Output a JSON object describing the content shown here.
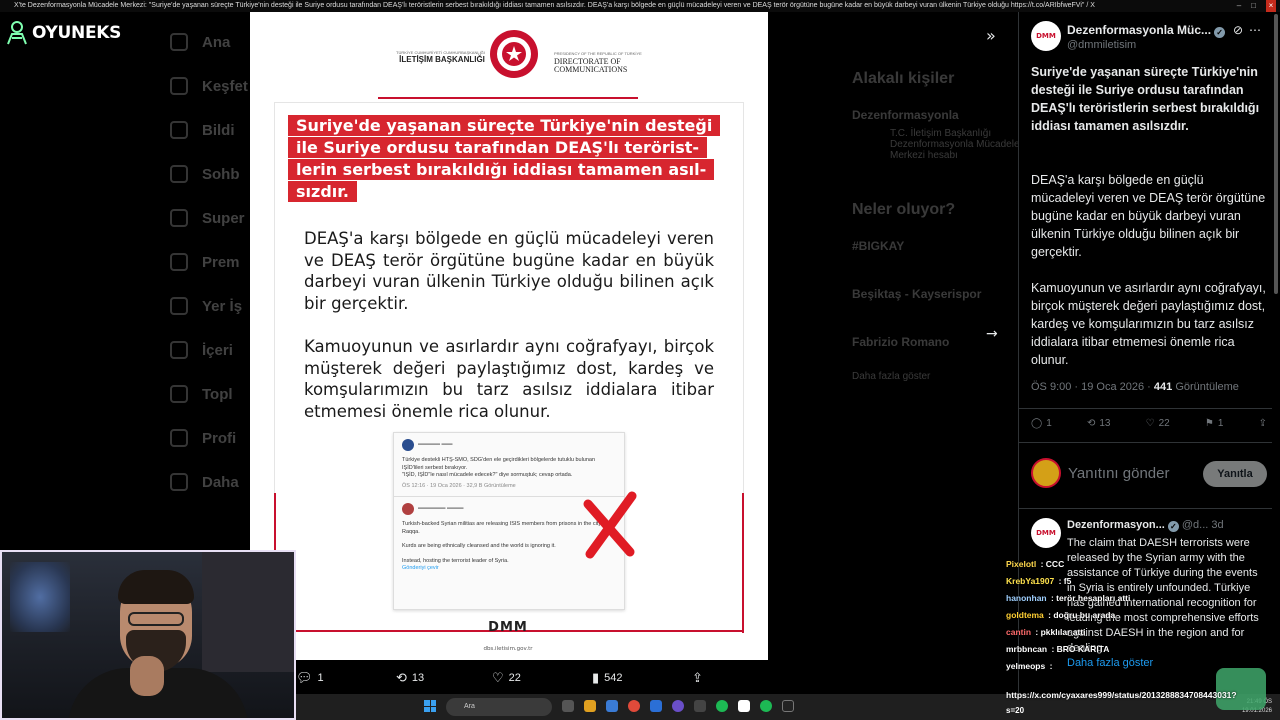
{
  "window": {
    "title": "X'te Dezenformasyonla Mücadele Merkezi: \"Suriye'de yaşanan süreçte Türkiye'nin desteği ile Suriye ordusu tarafından DEAŞ'lı teröristlerin serbest bırakıldığı iddiası tamamen asılsızdır. DEAŞ'a karşı bölgede en güçlü mücadeleyi veren ve DEAŞ terör örgütüne bugüne kadar en büyük darbeyi vuran ülkenin Türkiye olduğu https://t.co/ARIbfweFVi\" / X"
  },
  "overlay": {
    "logo_text": "OYUNEKS"
  },
  "leftnav": {
    "items": [
      "Ana",
      "Keşfet",
      "Bildi",
      "Sohb",
      "Super",
      "Prem",
      "Yer İş",
      "İçeri",
      "Topl",
      "Profi",
      "Daha"
    ]
  },
  "background_panel": {
    "related_title": "Alakalı kişiler",
    "related_name": "Dezenformasyonla",
    "related_bio": "T.C. İletişim Başkanlığı Dezenformasyonla Mücadele Merkezi hesabı",
    "trends_title": "Neler oluyor?",
    "trend1": "#BIGKAY",
    "trend2": "Beşiktaş - Kayserispor",
    "trend3": "Fabrizio Romano",
    "more": "Daha fazla göster"
  },
  "media": {
    "gov_left": "İLETİŞİM BAŞKANLIĞI",
    "gov_left_small": "TÜRKİYE CUMHURİYETİ CUMHURBAŞKANLIĞI",
    "gov_right_1": "DIRECTORATE OF",
    "gov_right_2": "COMMUNICATIONS",
    "gov_right_small": "PRESIDENCY OF THE REPUBLIC OF TÜRKİYE",
    "headline": "Suriye'de yaşanan süreçte Türkiye'nin desteği ile Suriye ordusu tarafından DEAŞ'lı terörist­lerin serbest bırakıldığı iddiası tamamen asıl­sızdır.",
    "body1": "DEAŞ'a karşı bölgede en güçlü mücadeleyi veren ve DEAŞ terör örgütüne bugüne kadar en büyük darbeyi vuran ülkenin Türkiye olduğu bilinen açık bir gerçektir.",
    "body2": "Kamuoyunun ve asırlardır aynı coğrafyayı, birçok müşterek değeri paylaştığımız dost, kardeş ve komşularımızın bu tarz asılsız iddia­lara itibar etmemesi önemle rica olunur.",
    "embed_text1": "Türkiye destekli HTŞ-SMO, SDG'den ele geçirdikleri bölgelerde tutuklu bulunan IŞİD'lileri serbest bırakıyor.",
    "embed_text2": "\"IŞİD, IŞİD\"le nasıl mücadele edecek?\" diye sormuştuk; cevap ortada.",
    "embed_meta": "ÖS 12:16 · 19 Oca 2026 · 32,9 B Görüntüleme",
    "embed_text3": "Turkish-backed Syrian militias are releasing ISIS members from prisons in the city of Raqqa.",
    "embed_text4": "Kurds are being ethnically cleansed and the world is ignoring it.",
    "embed_text5": "Instead, hosting the terrorist leader of Syria.",
    "embed_translate": "Gönderiyi çevir",
    "footer_logo": "DMM",
    "footer_url": "dbs.iletisim.gov.tr"
  },
  "media_actions": {
    "replies": "1",
    "reposts": "13",
    "likes": "22",
    "views": "542"
  },
  "tweet": {
    "display_name": "Dezenformasyonla Müc...",
    "handle": "@dmmiletisim",
    "avatar_text": "DMM",
    "bold_text": "Suriye'de yaşanan süreçte Türkiye'nin desteği ile Suriye ordusu tarafından DEAŞ'lı teröristlerin serbest bırakıldığı iddiası tamamen asılsızdır.",
    "para1": "DEAŞ'a karşı bölgede en güçlü mücadeleyi veren ve DEAŞ terör örgütüne bugüne kadar en büyük darbeyi vuran ülkenin Türkiye olduğu bilinen açık bir gerçektir.",
    "para2": "Kamuoyunun ve asırlardır aynı coğrafyayı, birçok müşterek değeri paylaştığımız dost, kardeş ve komşularımızın bu tarz asılsız iddialara itibar etmemesi önemle rica olunur.",
    "meta_time": "ÖS 9:00 · 19 Oca 2026 · ",
    "meta_views": "441",
    "meta_views_label": " Görüntüleme",
    "replies": "1",
    "reposts": "13",
    "likes": "22",
    "bookmarks": "1"
  },
  "reply": {
    "placeholder": "Yanıtını gönder",
    "button": "Yanıtla"
  },
  "reply_tweet": {
    "display_name": "Dezenformasyon...",
    "handle": "@d...",
    "time": "3d",
    "text": "The claim that DAESH terrorists were released by the Syrian army with the assistance of Türkiye during the events in Syria is entirely unfounded. Türkiye has gained international recognition for leading the most comprehensive efforts against DAESH in the region and for dealing",
    "more": "Daha fazla göster"
  },
  "chat": [
    {
      "user": "Pixelotl",
      "color": "#ffd84d",
      "msg": "CCC"
    },
    {
      "user": "KrebYa1907",
      "color": "#ffe34d",
      "msg": "f5"
    },
    {
      "user": "hanonhan",
      "color": "#9fd0ff",
      "msg": "terör hesapları atti"
    },
    {
      "user": "goldtema",
      "color": "#ffcf33",
      "msg": "doğru bu arada"
    },
    {
      "user": "cantin",
      "color": "#ff6b6b",
      "msg": "pkklılar atti"
    },
    {
      "user": "mrbbncan",
      "color": "#ffffff",
      "msg": "BRO KARITA"
    },
    {
      "user": "yelmeops",
      "color": "#ffffff",
      "msg": ""
    }
  ],
  "status_url": "https://x.com/cyaxares999/status/2013288834708443031?",
  "status_extra": "s=20",
  "taskbar": {
    "search": "Ara",
    "time": "21:49 ÖS",
    "date": "19.01.2026"
  }
}
